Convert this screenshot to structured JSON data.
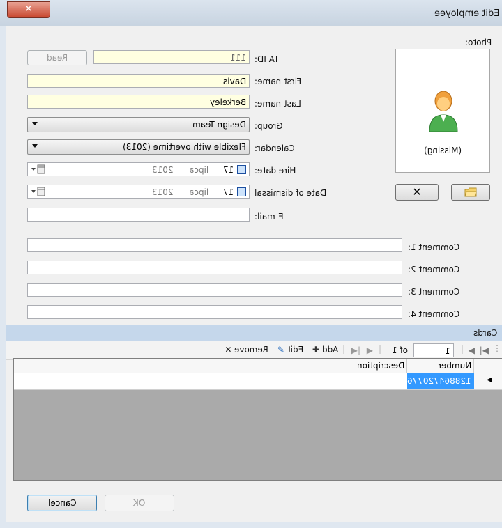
{
  "window": {
    "title": "Edit employee",
    "close_glyph": "✕"
  },
  "form": {
    "ta_id": {
      "label": "TA ID:",
      "value": "111",
      "read_button": "Read"
    },
    "first_name": {
      "label": "First name:",
      "value": "Davis"
    },
    "last_name": {
      "label": "Last name:",
      "value": "Berkeley"
    },
    "group": {
      "label": "Group:",
      "value": "Design Team"
    },
    "calendar": {
      "label": "Calendar:",
      "value": "Flexible with overtime (2013)"
    },
    "hire_date": {
      "label": "Hire date:",
      "day": "17",
      "month": "lipca",
      "year": "2013"
    },
    "dismissal_date": {
      "label": "Date of dismissal",
      "day": "17",
      "month": "lipca",
      "year": "2013"
    },
    "email": {
      "label": "E-mail:",
      "value": ""
    },
    "comments": [
      {
        "label": "Comment 1:",
        "value": ""
      },
      {
        "label": "Comment 2:",
        "value": ""
      },
      {
        "label": "Comment 3:",
        "value": ""
      },
      {
        "label": "Comment 4:",
        "value": ""
      }
    ]
  },
  "photo": {
    "label": "Photo:",
    "status": "(Missing)",
    "clear_button": "✕"
  },
  "cards": {
    "section_title": "Cards",
    "navigator": {
      "position": "1",
      "of_label": "of 1"
    },
    "actions": {
      "add": "Add",
      "edit": "Edit",
      "remove": "Remove"
    },
    "columns": [
      "Number",
      "Description"
    ],
    "rows": [
      {
        "number": "128864720776",
        "description": ""
      }
    ]
  },
  "buttons": {
    "ok": "OK",
    "cancel": "Cancel"
  },
  "colors": {
    "required_field": "#ffffe1",
    "section_header": "#c5d7eb",
    "selected_cell": "#3399ff"
  }
}
